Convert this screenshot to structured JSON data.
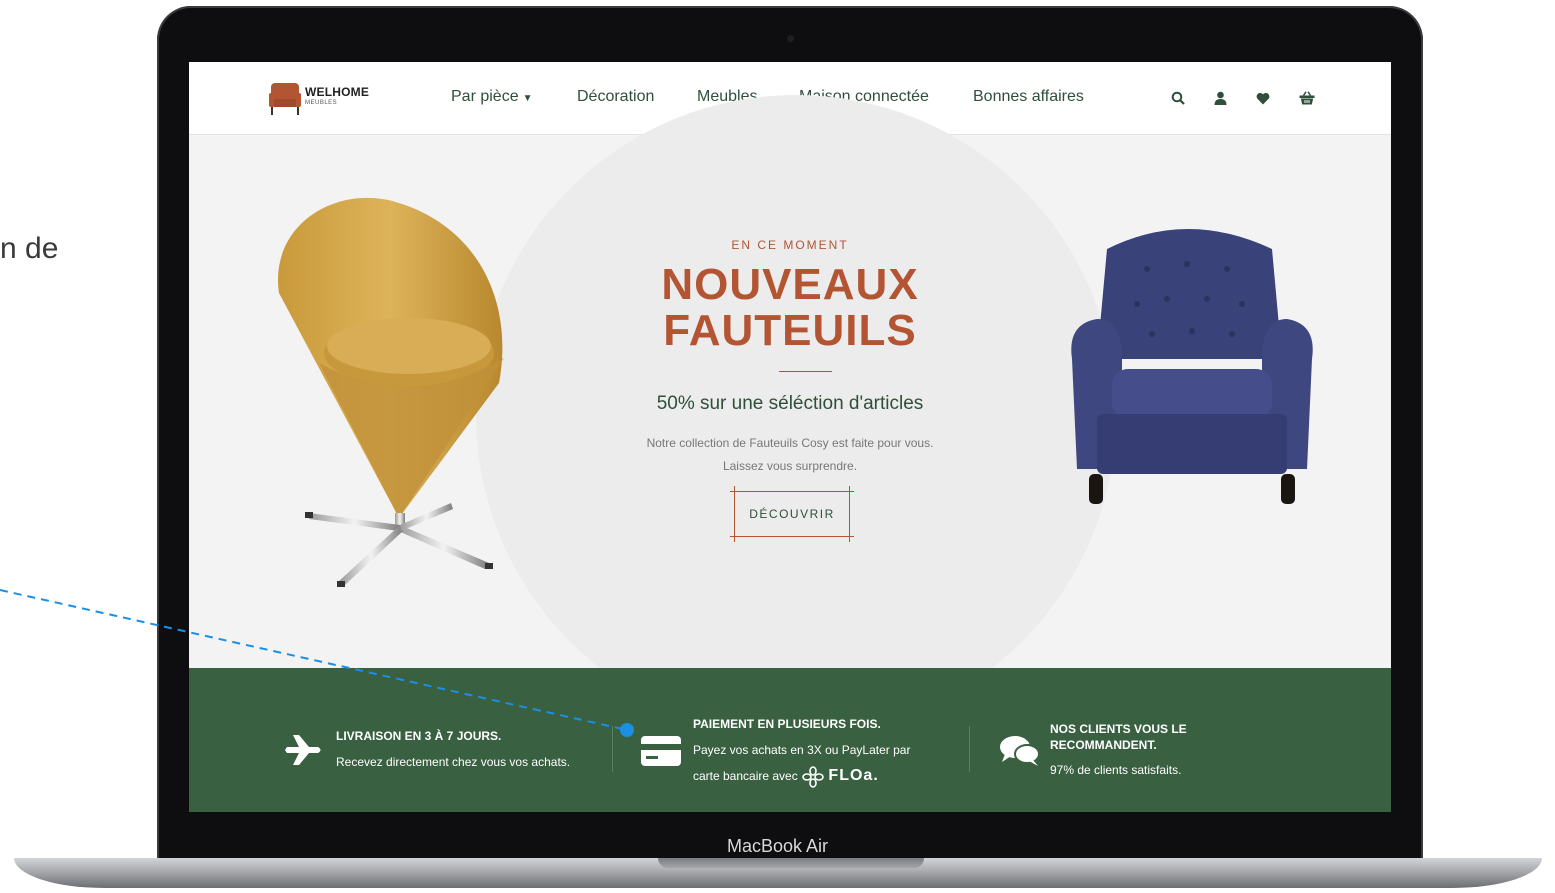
{
  "page": {
    "side_text": "n de"
  },
  "device": {
    "label": "MacBook Air"
  },
  "header": {
    "logo": {
      "name": "WELHOME",
      "sub": "MEUBLES"
    },
    "nav": [
      {
        "label": "Par pièce",
        "has_dropdown": true
      },
      {
        "label": "Décoration"
      },
      {
        "label": "Meubles"
      },
      {
        "label": "Maison connectée"
      },
      {
        "label": "Bonnes affaires"
      }
    ],
    "icons": [
      "search-icon",
      "account-icon",
      "heart-icon",
      "basket-icon"
    ]
  },
  "hero": {
    "eyebrow": "EN CE MOMENT",
    "title_line1": "NOUVEAUX",
    "title_line2": "FAUTEUILS",
    "subtitle": "50% sur une séléction d'articles",
    "description_line1": "Notre collection de Fauteuils Cosy est faite pour vous.",
    "description_line2": "Laissez vous surprendre.",
    "cta": "DÉCOUVRIR"
  },
  "features": [
    {
      "icon": "plane-icon",
      "title": "LIVRAISON EN 3 À 7 JOURS.",
      "text": "Recevez directement chez vous vos achats."
    },
    {
      "icon": "credit-card-icon",
      "title": "PAIEMENT EN PLUSIEURS FOIS.",
      "text_line1": "Payez vos achats en 3X ou PayLater par",
      "text_line2": "carte bancaire avec",
      "brand": "FLOa."
    },
    {
      "icon": "chat-icon",
      "title_line1": "NOS CLIENTS VOUS LE",
      "title_line2": "RECOMMANDENT.",
      "text": "97% de clients satisfaits."
    }
  ],
  "colors": {
    "accent": "#b35533",
    "brand_green": "#3a6042",
    "nav_text": "#2f4f3a",
    "annotation": "#1a8fe3"
  }
}
